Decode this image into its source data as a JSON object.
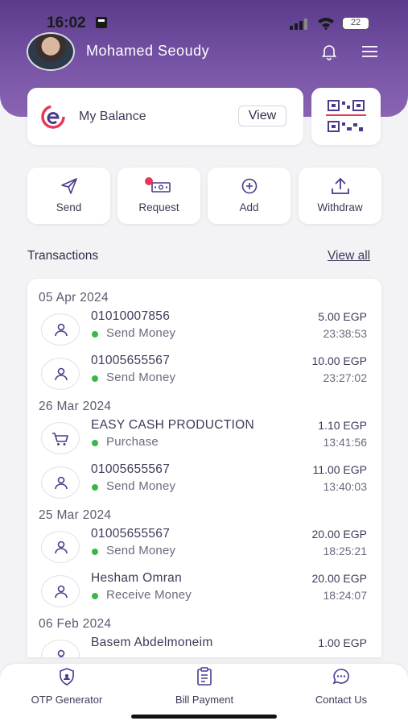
{
  "status_bar": {
    "time": "16:02",
    "battery": "22"
  },
  "header": {
    "user_name": "Mohamed Seoudy"
  },
  "balance": {
    "label": "My Balance",
    "view_label": "View"
  },
  "actions": [
    {
      "label": "Send",
      "icon": "send-icon"
    },
    {
      "label": "Request",
      "icon": "request-icon"
    },
    {
      "label": "Add",
      "icon": "add-circle-icon"
    },
    {
      "label": "Withdraw",
      "icon": "upload-icon"
    }
  ],
  "transactions": {
    "title": "Transactions",
    "view_all": "View all",
    "groups": [
      {
        "date": "05 Apr 2024",
        "items": [
          {
            "name": "01010007856",
            "type": "Send Money",
            "amount": "5.00 EGP",
            "time": "23:38:53",
            "icon": "person-icon"
          },
          {
            "name": "01005655567",
            "type": "Send Money",
            "amount": "10.00 EGP",
            "time": "23:27:02",
            "icon": "person-icon"
          }
        ]
      },
      {
        "date": "26 Mar 2024",
        "items": [
          {
            "name": "EASY CASH PRODUCTION",
            "type": "Purchase",
            "amount": "1.10 EGP",
            "time": "13:41:56",
            "icon": "cart-icon"
          },
          {
            "name": "01005655567",
            "type": "Send Money",
            "amount": "11.00 EGP",
            "time": "13:40:03",
            "icon": "person-icon"
          }
        ]
      },
      {
        "date": "25 Mar 2024",
        "items": [
          {
            "name": "01005655567",
            "type": "Send Money",
            "amount": "20.00 EGP",
            "time": "18:25:21",
            "icon": "person-icon"
          },
          {
            "name": "Hesham Omran",
            "type": "Receive Money",
            "amount": "20.00 EGP",
            "time": "18:24:07",
            "icon": "person-icon"
          }
        ]
      },
      {
        "date": "06 Feb 2024",
        "items": [
          {
            "name": "Basem Abdelmoneim",
            "type": "",
            "amount": "1.00 EGP",
            "time": "",
            "icon": "person-icon"
          }
        ]
      }
    ]
  },
  "bottom_nav": [
    {
      "label": "OTP Generator",
      "icon": "shield-icon"
    },
    {
      "label": "Bill Payment",
      "icon": "bill-icon"
    },
    {
      "label": "Contact Us",
      "icon": "chat-icon"
    }
  ],
  "colors": {
    "header": "#6a48a0",
    "accent": "#e63956",
    "status_dot": "#3cb64a",
    "text": "#3b3b58"
  }
}
